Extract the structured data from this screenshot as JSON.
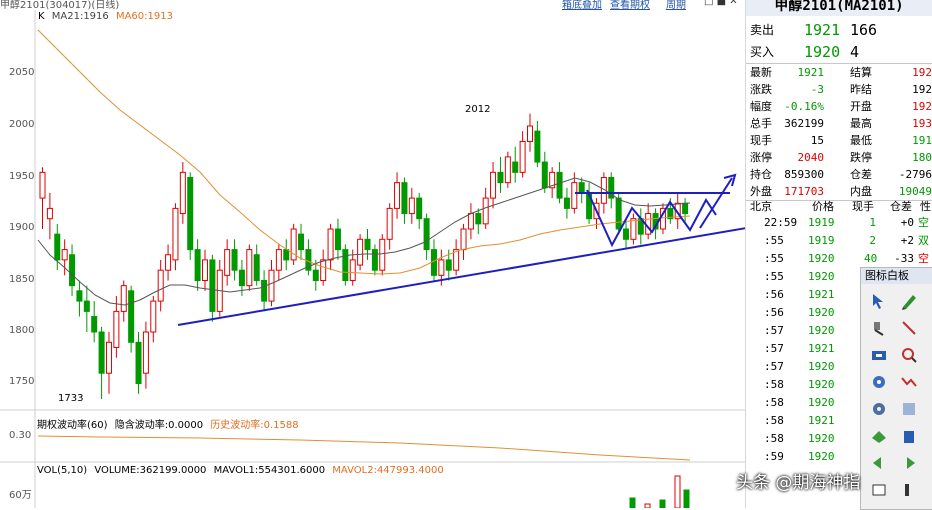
{
  "chart": {
    "topbar_title": "甲醇2101(304017)(日线)",
    "topbar_links": [
      "箱底叠加",
      "查看期权",
      "周期"
    ],
    "legend_main": {
      "prefix": "K",
      "ma21": "MA21:1916",
      "ma60": "MA60:1913"
    },
    "y_ticks": [
      "2050",
      "2000",
      "1950",
      "1900",
      "1850",
      "1800",
      "1750"
    ],
    "annotations": {
      "high": "2012",
      "low": "1733"
    },
    "vol_indicator": {
      "name": "期权波动率(60)",
      "implied": "隐含波动率:0.0000",
      "historical": "历史波动率:0.1588",
      "tick": "0.30"
    },
    "volume": {
      "name": "VOL(5,10)",
      "volume": "VOLUME:362199.0000",
      "mavol1": "MAVOL1:554301.6000",
      "mavol2": "MAVOL2:447993.4000",
      "tick": "60万"
    },
    "colors": {
      "up": "#e00000",
      "down": "#009900",
      "ma21": "#555555",
      "ma60": "#e09030",
      "trendline": "#1f1fbf"
    }
  },
  "panel": {
    "title": "甲醇2101(MA2101)",
    "sell": {
      "label": "卖出",
      "price": "1921",
      "vol": "166"
    },
    "buy": {
      "label": "买入",
      "price": "1920",
      "vol": "4"
    },
    "quote_rows": [
      {
        "l1": "最新",
        "v1": "1921",
        "c1": "green",
        "l2": "结算",
        "v2": "192",
        "c2": "red"
      },
      {
        "l1": "涨跌",
        "v1": "-3",
        "c1": "green",
        "l2": "昨结",
        "v2": "192",
        "c2": "black"
      },
      {
        "l1": "幅度",
        "v1": "-0.16%",
        "c1": "green",
        "l2": "开盘",
        "v2": "192",
        "c2": "red"
      },
      {
        "l1": "总手",
        "v1": "362199",
        "c1": "black",
        "l2": "最高",
        "v2": "193",
        "c2": "red"
      },
      {
        "l1": "现手",
        "v1": "15",
        "c1": "black",
        "l2": "最低",
        "v2": "191",
        "c2": "green"
      },
      {
        "l1": "涨停",
        "v1": "2040",
        "c1": "red",
        "l2": "跌停",
        "v2": "180",
        "c2": "green"
      },
      {
        "l1": "持仓",
        "v1": "859300",
        "c1": "black",
        "l2": "仓差",
        "v2": "-2796",
        "c2": "black"
      },
      {
        "l1": "外盘",
        "v1": "171703",
        "c1": "red",
        "l2": "内盘",
        "v2": "19049",
        "c2": "green"
      }
    ],
    "tick_header": {
      "place": "北京",
      "price": "价格",
      "vol": "现手",
      "chg": "仓差",
      "nat": "性"
    },
    "ticks": [
      {
        "time": "22:59",
        "price": "1919",
        "pc": "green",
        "vol": "1",
        "chg": "+0",
        "nat": "空",
        "nc": "green"
      },
      {
        "time": ":55",
        "price": "1919",
        "pc": "green",
        "vol": "2",
        "chg": "+2",
        "nat": "双",
        "nc": "green"
      },
      {
        "time": ":55",
        "price": "1920",
        "pc": "green",
        "vol": "40",
        "chg": "-33",
        "nat": "空",
        "nc": "red"
      },
      {
        "time": ":55",
        "price": "1920",
        "pc": "green",
        "vol": "",
        "chg": "",
        "nat": "",
        "nc": "green"
      },
      {
        "time": ":56",
        "price": "1921",
        "pc": "green",
        "vol": "",
        "chg": "",
        "nat": "",
        "nc": "green"
      },
      {
        "time": ":56",
        "price": "1920",
        "pc": "green",
        "vol": "",
        "chg": "",
        "nat": "",
        "nc": "green"
      },
      {
        "time": ":57",
        "price": "1920",
        "pc": "green",
        "vol": "",
        "chg": "",
        "nat": "",
        "nc": "green"
      },
      {
        "time": ":57",
        "price": "1921",
        "pc": "green",
        "vol": "",
        "chg": "",
        "nat": "",
        "nc": "green"
      },
      {
        "time": ":57",
        "price": "1920",
        "pc": "green",
        "vol": "",
        "chg": "",
        "nat": "",
        "nc": "green"
      },
      {
        "time": ":58",
        "price": "1920",
        "pc": "green",
        "vol": "",
        "chg": "",
        "nat": "",
        "nc": "green"
      },
      {
        "time": ":58",
        "price": "1920",
        "pc": "green",
        "vol": "",
        "chg": "",
        "nat": "",
        "nc": "green"
      },
      {
        "time": ":58",
        "price": "1921",
        "pc": "green",
        "vol": "",
        "chg": "",
        "nat": "",
        "nc": "green"
      },
      {
        "time": ":58",
        "price": "1920",
        "pc": "green",
        "vol": "",
        "chg": "",
        "nat": "",
        "nc": "green"
      },
      {
        "time": ":59",
        "price": "1920",
        "pc": "green",
        "vol": "",
        "chg": "",
        "nat": "",
        "nc": "green"
      }
    ],
    "palette_title": "图标白板",
    "palette_tools": [
      "pointer-icon",
      "pencil-icon",
      "brush-icon",
      "line-icon",
      "eraser-icon",
      "zoom-icon",
      "screen-icon",
      "arrow-icon",
      "gear-icon",
      "wave-icon",
      "image-icon",
      "shape-icon",
      "bucket-icon",
      "back-arrow-icon",
      "rectangle-icon",
      "cursor-icon"
    ]
  },
  "watermark": "头条 @期海神指"
}
